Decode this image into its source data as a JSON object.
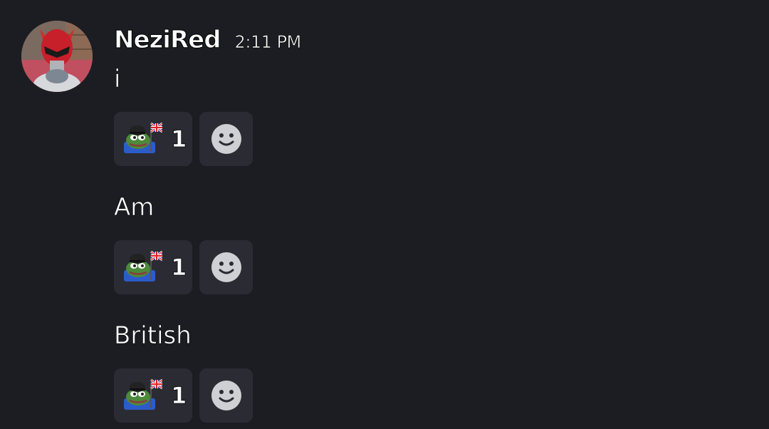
{
  "author": {
    "name": "NeziRed",
    "timestamp": "2:11 PM"
  },
  "messages": [
    {
      "text": "i",
      "reaction": {
        "emoji": "pepe-british-flag-emoji",
        "count": "1"
      },
      "add_reaction_icon": "smiley-icon"
    },
    {
      "text": "Am",
      "reaction": {
        "emoji": "pepe-british-flag-emoji",
        "count": "1"
      },
      "add_reaction_icon": "smiley-icon"
    },
    {
      "text": "British",
      "reaction": {
        "emoji": "pepe-british-flag-emoji",
        "count": "1"
      },
      "add_reaction_icon": "smiley-icon"
    }
  ],
  "colors": {
    "background": "#1c1d22",
    "reaction_bg": "#2b2c33",
    "text": "#ffffff",
    "icon": "#cfd0d4"
  }
}
